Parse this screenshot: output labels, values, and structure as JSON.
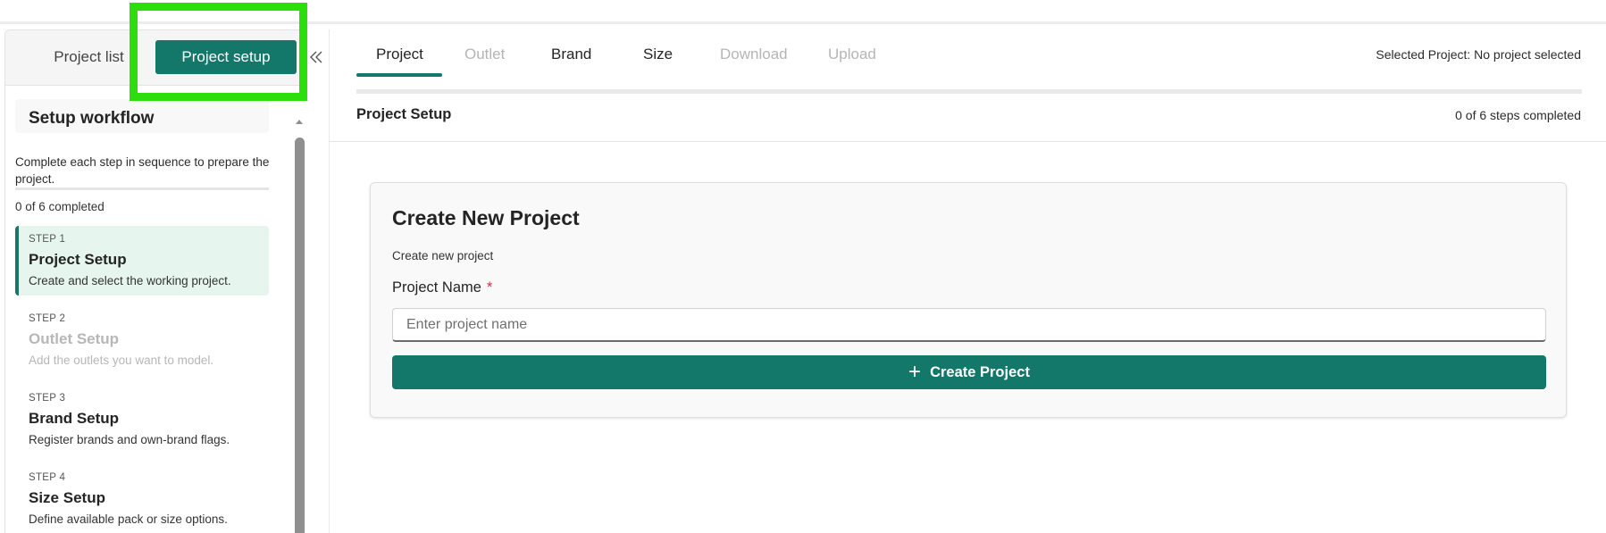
{
  "sidebar": {
    "tabs": {
      "list_label": "Project list",
      "setup_label": "Project setup"
    },
    "collapse_icon": "double-chevron-left-icon",
    "workflow": {
      "title": "Setup workflow",
      "description": "Complete each step in sequence to prepare the project.",
      "progress_fraction": 0,
      "completed_text": "0 of 6 completed",
      "steps": [
        {
          "number": "STEP 1",
          "title": "Project Setup",
          "description": "Create and select the working project.",
          "state": "active"
        },
        {
          "number": "STEP 2",
          "title": "Outlet Setup",
          "description": "Add the outlets you want to model.",
          "state": "disabled"
        },
        {
          "number": "STEP 3",
          "title": "Brand Setup",
          "description": "Register brands and own-brand flags.",
          "state": "enabled"
        },
        {
          "number": "STEP 4",
          "title": "Size Setup",
          "description": "Define available pack or size options.",
          "state": "enabled"
        }
      ]
    }
  },
  "nav": {
    "tabs": [
      {
        "label": "Project",
        "state": "active"
      },
      {
        "label": "Outlet",
        "state": "disabled"
      },
      {
        "label": "Brand",
        "state": "enabled"
      },
      {
        "label": "Size",
        "state": "enabled"
      },
      {
        "label": "Download",
        "state": "disabled"
      },
      {
        "label": "Upload",
        "state": "disabled"
      }
    ],
    "selected_project": "Selected Project: No project selected"
  },
  "section": {
    "title": "Project Setup",
    "steps_completed": "0 of 6 steps completed"
  },
  "card": {
    "title": "Create New Project",
    "subtitle": "Create new project",
    "field_label": "Project Name",
    "required_mark": "*",
    "input_value": "",
    "input_placeholder": "Enter project name",
    "button_label": "Create Project",
    "button_icon": "plus-icon"
  },
  "colors": {
    "accent": "#13776a",
    "highlight": "#2cdf0c",
    "active_step_bg": "#e6f6ef",
    "required": "#c4314b"
  }
}
